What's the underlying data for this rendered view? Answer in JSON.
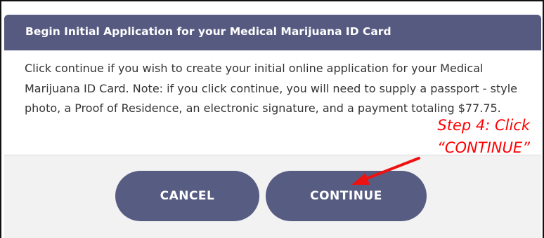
{
  "dialog": {
    "title": "Begin Initial Application for your Medical Marijuana ID Card",
    "body": "Click continue if you wish to create your initial online application for your Medical Marijuana ID Card. Note: if you click continue, you will need to supply a passport - style photo, a Proof of Residence, an electronic signature, and a payment totaling $77.75.",
    "cancel_label": "CANCEL",
    "continue_label": "CONTINUE"
  },
  "annotation": {
    "line1": "Step 4: Click",
    "line2": "“CONTINUE”"
  },
  "colors": {
    "header": "#565a80",
    "button": "#575c82",
    "annotation": "#ff0000"
  }
}
